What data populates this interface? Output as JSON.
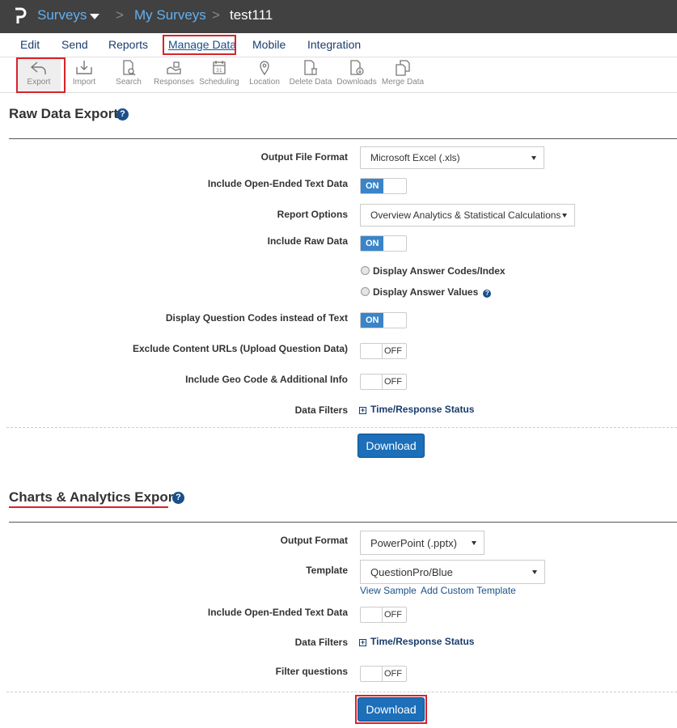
{
  "topbar": {
    "app_label": "Surveys",
    "breadcrumb_parent": "My Surveys",
    "breadcrumb_current": "test111",
    "separator": ">"
  },
  "tabs": [
    {
      "label": "Edit"
    },
    {
      "label": "Send"
    },
    {
      "label": "Reports"
    },
    {
      "label": "Manage Data",
      "active": true
    },
    {
      "label": "Mobile"
    },
    {
      "label": "Integration"
    }
  ],
  "toolbar": {
    "items": [
      {
        "label": "Export",
        "icon": "export-icon",
        "selected": true
      },
      {
        "label": "Import",
        "icon": "import-icon"
      },
      {
        "label": "Search",
        "icon": "search-icon"
      },
      {
        "label": "Responses",
        "icon": "responses-icon"
      },
      {
        "label": "Scheduling",
        "icon": "calendar-icon"
      },
      {
        "label": "Location",
        "icon": "location-pin-icon"
      },
      {
        "label": "Delete Data",
        "icon": "delete-data-icon"
      },
      {
        "label": "Downloads",
        "icon": "downloads-icon"
      },
      {
        "label": "Merge Data",
        "icon": "merge-data-icon"
      }
    ]
  },
  "raw_export": {
    "title": "Raw Data Export",
    "help": "?",
    "output_format_label": "Output File Format",
    "output_format_value": "Microsoft Excel (.xls)",
    "open_ended_label": "Include Open-Ended Text Data",
    "open_ended_state": "ON",
    "report_options_label": "Report Options",
    "report_options_value": "Overview Analytics & Statistical Calculations",
    "include_raw_label": "Include Raw Data",
    "include_raw_state": "ON",
    "radio_codes": "Display Answer Codes/Index",
    "radio_values": "Display Answer Values",
    "question_codes_label": "Display Question Codes instead of Text",
    "question_codes_state": "ON",
    "exclude_urls_label": "Exclude Content URLs (Upload Question Data)",
    "exclude_urls_state": "OFF",
    "geo_label": "Include Geo Code & Additional Info",
    "geo_state": "OFF",
    "filters_label": "Data Filters",
    "filters_link": "Time/Response Status",
    "download": "Download"
  },
  "charts_export": {
    "title": "Charts & Analytics Export",
    "help": "?",
    "output_format_label": "Output Format",
    "output_format_value": "PowerPoint (.pptx)",
    "template_label": "Template",
    "template_value": "QuestionPro/Blue",
    "view_sample": "View Sample",
    "add_template": "Add Custom Template",
    "open_ended_label": "Include Open-Ended Text Data",
    "open_ended_state": "OFF",
    "filters_label": "Data Filters",
    "filters_link": "Time/Response Status",
    "filter_questions_label": "Filter questions",
    "filter_questions_state": "OFF",
    "download": "Download"
  },
  "colors": {
    "topbar": "#414141",
    "link_blue": "#63b0f0",
    "toggle_on": "#3a84c9",
    "button": "#1c6fb8",
    "highlight": "#d9222a"
  }
}
